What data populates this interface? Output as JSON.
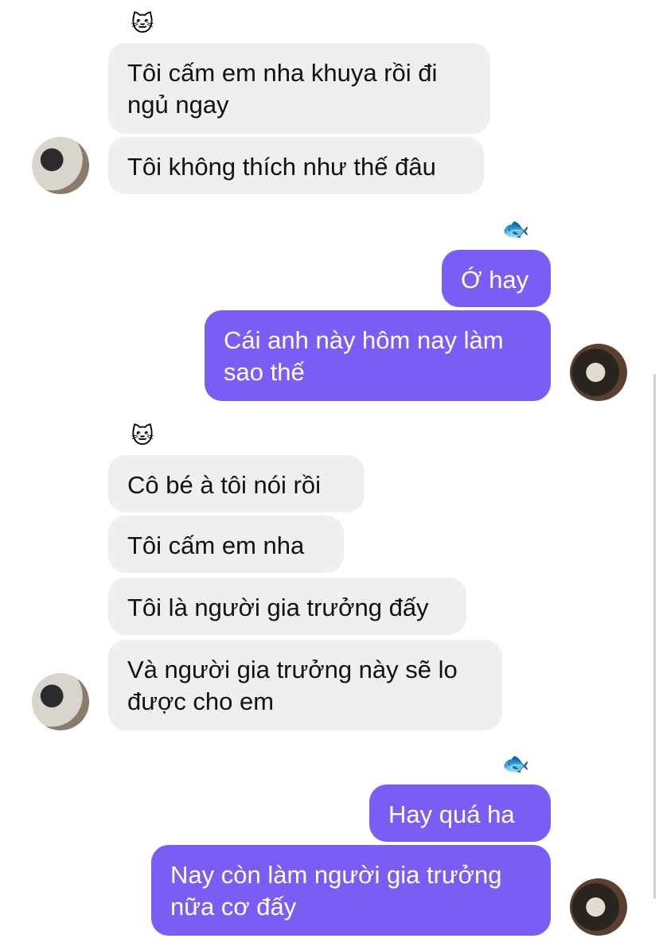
{
  "contact": {
    "nickname_icon": "cat-face-icon",
    "nickname_emoji": "🐱"
  },
  "me": {
    "nickname_icon": "fish-icon",
    "nickname_emoji": "🐟"
  },
  "colors": {
    "incoming_bubble": "#efefef",
    "outgoing_bubble": "#7b5cf5"
  },
  "messages": [
    {
      "from": "contact",
      "text": "Tôi cấm em nha khuya rồi đi\nngủ ngay"
    },
    {
      "from": "contact",
      "text": "Tôi không thích như thế đâu"
    },
    {
      "from": "me",
      "text": "Ớ hay"
    },
    {
      "from": "me",
      "text": "Cái anh này hôm nay làm\nsao thế"
    },
    {
      "from": "contact",
      "text": "Cô bé à tôi nói rồi"
    },
    {
      "from": "contact",
      "text": "Tôi cấm em nha"
    },
    {
      "from": "contact",
      "text": "Tôi là người gia trưởng đấy"
    },
    {
      "from": "contact",
      "text": "Và người gia trưởng này sẽ lo\nđược cho em"
    },
    {
      "from": "me",
      "text": "Hay quá ha"
    },
    {
      "from": "me",
      "text": "Nay còn làm người gia trưởng\nnữa cơ đấy"
    }
  ]
}
